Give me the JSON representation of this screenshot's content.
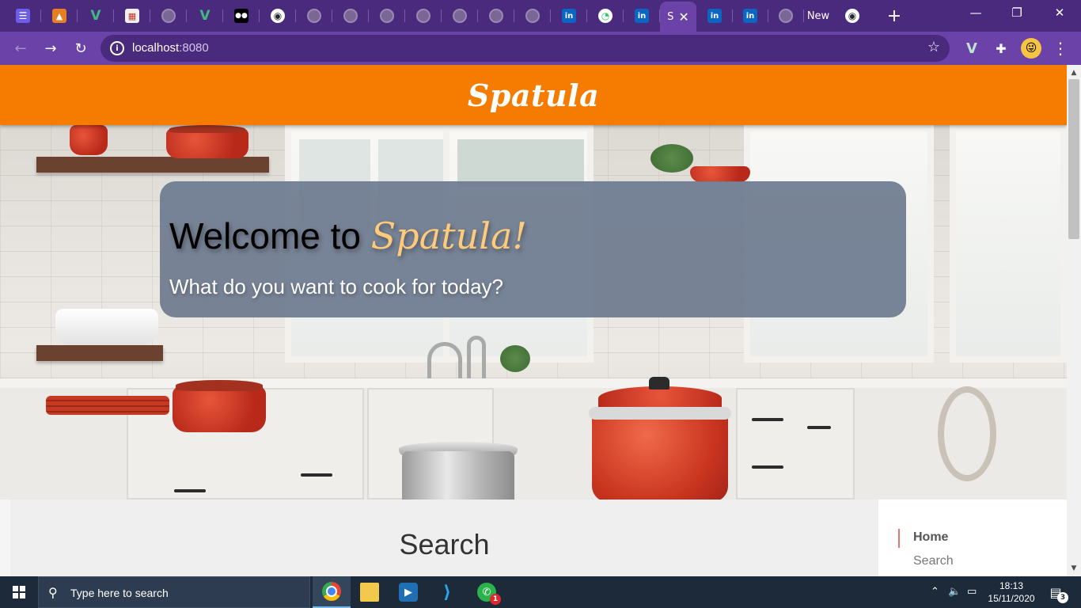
{
  "browser": {
    "tabs": [
      {
        "icon": "list-icon",
        "glyph": "☰",
        "kind": "list"
      },
      {
        "icon": "triangle-logo-icon",
        "glyph": "▲",
        "kind": "tri"
      },
      {
        "icon": "vue-icon",
        "glyph": "V",
        "kind": "vue"
      },
      {
        "icon": "calendar-icon",
        "glyph": "▦",
        "kind": "cal"
      },
      {
        "icon": "globe-icon",
        "glyph": "",
        "kind": "globe"
      },
      {
        "icon": "vue-icon",
        "glyph": "V",
        "kind": "vue"
      },
      {
        "icon": "medium-icon",
        "glyph": "●●",
        "kind": "med"
      },
      {
        "icon": "github-icon",
        "glyph": "◉",
        "kind": "gh"
      },
      {
        "icon": "globe-icon",
        "glyph": "",
        "kind": "globe"
      },
      {
        "icon": "globe-icon",
        "glyph": "",
        "kind": "globe"
      },
      {
        "icon": "globe-icon",
        "glyph": "",
        "kind": "globe"
      },
      {
        "icon": "globe-icon",
        "glyph": "",
        "kind": "globe"
      },
      {
        "icon": "globe-icon",
        "glyph": "",
        "kind": "globe"
      },
      {
        "icon": "globe-icon",
        "glyph": "",
        "kind": "globe"
      },
      {
        "icon": "globe-icon",
        "glyph": "",
        "kind": "globe"
      },
      {
        "icon": "linkedin-icon",
        "glyph": "in",
        "kind": "li"
      },
      {
        "icon": "pie-chart-icon",
        "glyph": "◔",
        "kind": "dot"
      },
      {
        "icon": "linkedin-icon",
        "glyph": "in",
        "kind": "li"
      }
    ],
    "active_tab": {
      "text": "S",
      "close": "✕"
    },
    "tabs_after": [
      {
        "icon": "linkedin-icon",
        "glyph": "in",
        "kind": "li"
      },
      {
        "icon": "linkedin-icon",
        "glyph": "in",
        "kind": "li"
      },
      {
        "icon": "globe-icon",
        "glyph": "",
        "kind": "globe"
      }
    ],
    "new_tab_text": "New",
    "new_tab_button": "+",
    "window_controls": {
      "minimize": "—",
      "restore": "❐",
      "close": "✕"
    },
    "nav": {
      "back": "←",
      "forward": "→",
      "reload": "↻"
    },
    "address": {
      "info": "i",
      "host": "localhost",
      "port": ":8080",
      "star": "☆"
    },
    "extensions": {
      "vue_devtools": "V",
      "puzzle": "✚",
      "menu": "⋮",
      "avatar": "😜"
    }
  },
  "page": {
    "brand": "Spatula",
    "welcome_prefix": "Welcome to ",
    "welcome_accent": "Spatula!",
    "welcome_subtitle": "What do you want to cook for today?",
    "search_heading": "Search",
    "side_nav": {
      "home": "Home",
      "search": "Search"
    }
  },
  "taskbar": {
    "search_placeholder": "Type here to search",
    "whatsapp_badge": "1",
    "time": "18:13",
    "date": "15/11/2020",
    "notification_count": "3"
  },
  "colors": {
    "browser_frame": "#4a2a7d",
    "browser_toolbar": "#6b42a8",
    "app_header": "#f57c00",
    "welcome_card": "#6e7b8f",
    "brand_accent": "#ffcb7a",
    "taskbar": "#1d2a3a"
  }
}
